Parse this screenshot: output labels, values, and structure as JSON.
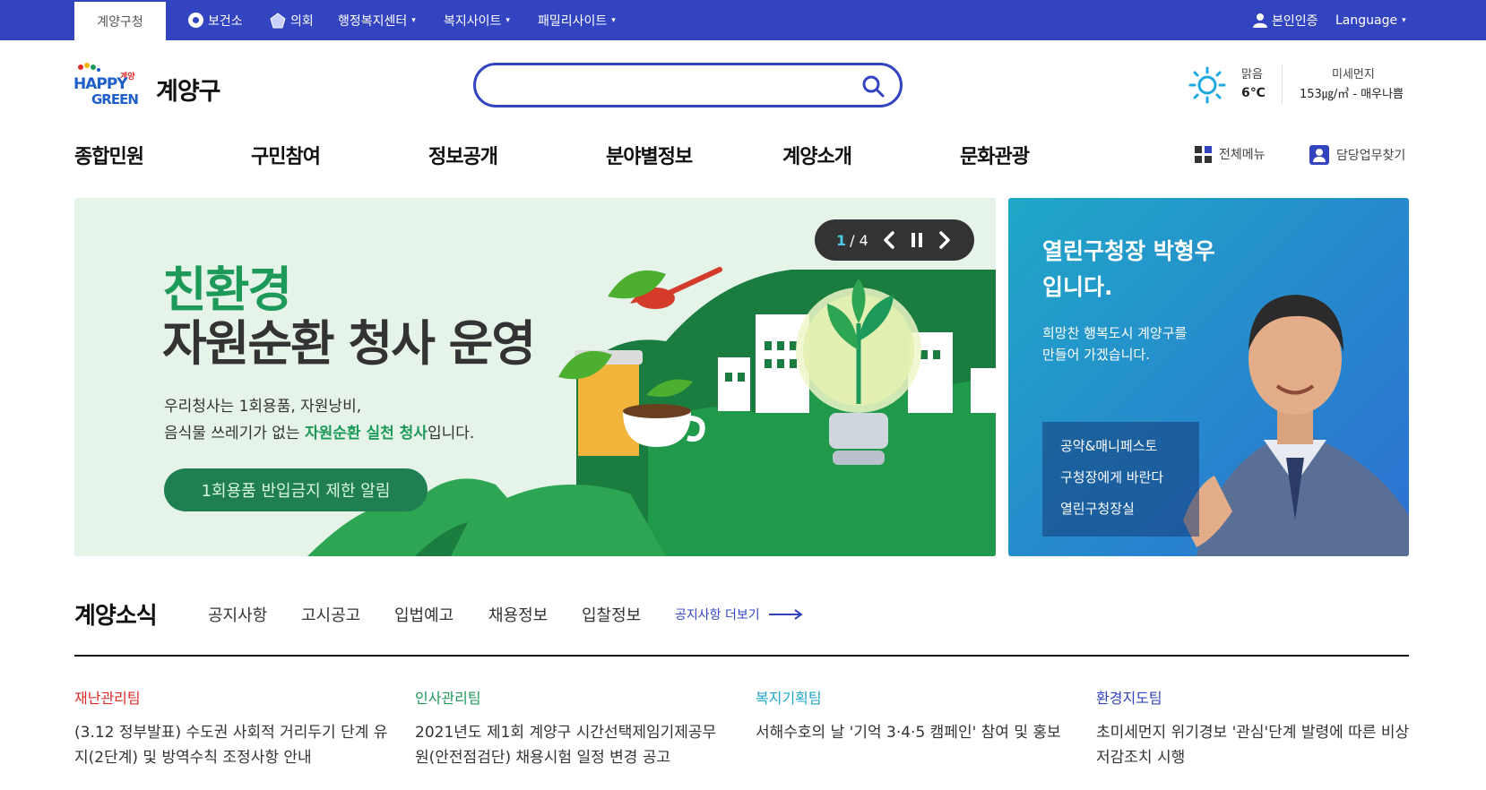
{
  "topbar": {
    "home_tab": "계양구청",
    "links": [
      {
        "label": "보건소",
        "icon": "health-center-icon"
      },
      {
        "label": "의회",
        "icon": "council-emblem-icon"
      },
      {
        "label": "행정복지센터",
        "caret": "▾"
      },
      {
        "label": "복지사이트",
        "caret": "▾"
      },
      {
        "label": "패밀리사이트",
        "caret": "▾"
      }
    ],
    "auth": "본인인증",
    "language": "Language",
    "language_caret": "▾"
  },
  "header": {
    "logo_happy": "HAPPY",
    "logo_green": "GREEN",
    "logo_small": "계양",
    "district_name": "계양구",
    "search_placeholder": "",
    "weather": {
      "state": "맑음",
      "temp": "6℃",
      "icon": "sun-icon"
    },
    "dust": {
      "label": "미세먼지",
      "value": "153㎍/㎥ - 매우나쁨"
    }
  },
  "gnb": {
    "items": [
      "종합민원",
      "구민참여",
      "정보공개",
      "분야별정보",
      "계양소개",
      "문화관광"
    ],
    "all_menu": "전체메뉴",
    "staff_search": "담당업무찾기"
  },
  "banner": {
    "title_line1": "친환경",
    "title_line2": "자원순환 청사 운영",
    "desc_line1": "우리청사는 1회용품, 자원낭비,",
    "desc_line2_prefix": "음식물 쓰레기가 없는 ",
    "desc_line2_highlight": "자원순환 실천 청사",
    "desc_line2_suffix": "입니다.",
    "cta": "1회용품 반입금지 제한 알림",
    "slider": {
      "current": "1",
      "separator": "/",
      "total": "4"
    }
  },
  "mayor": {
    "title_line1": "열린구청장 박형우",
    "title_line2": "입니다.",
    "desc_line1": "희망찬 행복도시 계양구를",
    "desc_line2": "만들어 가겠습니다.",
    "links": [
      "공약&매니페스토",
      "구청장에게 바란다",
      "열린구청장실"
    ]
  },
  "news": {
    "title": "계양소식",
    "tabs": [
      "공지사항",
      "고시공고",
      "입법예고",
      "채용정보",
      "입찰정보"
    ],
    "more": "공지사항 더보기",
    "items": [
      {
        "dept": "재난관리팀",
        "dept_color": "#e02a2a",
        "headline": "(3.12 정부발표) 수도권 사회적 거리두기 단계 유지(2단계) 및 방역수칙 조정사항 안내"
      },
      {
        "dept": "인사관리팀",
        "dept_color": "#1d9a5a",
        "headline": "2021년도 제1회 계양구 시간선택제임기제공무원(안전점검단) 채용시험 일정 변경 공고"
      },
      {
        "dept": "복지기획팀",
        "dept_color": "#1fa7c7",
        "headline": "서해수호의 날 '기억 3·4·5 캠페인' 참여 및 홍보"
      },
      {
        "dept": "환경지도팀",
        "dept_color": "#3344c0",
        "headline": "초미세먼지 위기경보 '관심'단계 발령에 따른 비상저감조치 시행"
      }
    ]
  },
  "colors": {
    "brand": "#3344c0",
    "green": "#1d9a5a",
    "dark_green": "#1f7f52"
  }
}
